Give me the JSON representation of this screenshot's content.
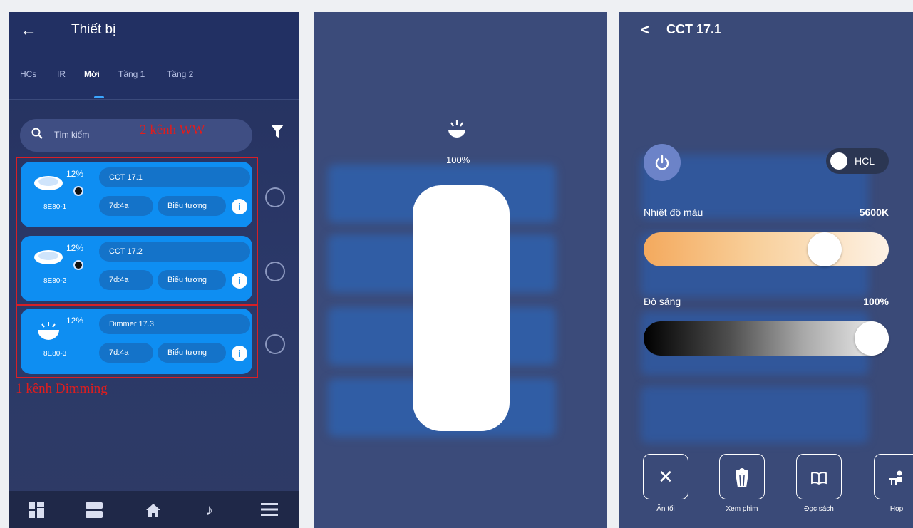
{
  "panel1": {
    "header": {
      "back_icon": "arrow-left-icon",
      "title": "Thiết bị"
    },
    "tabs": [
      {
        "label": "HCs",
        "active": false
      },
      {
        "label": "IR",
        "active": false
      },
      {
        "label": "Mới",
        "active": true
      },
      {
        "label": "Tầng 1",
        "active": false
      },
      {
        "label": "Tầng 2",
        "active": false
      }
    ],
    "search": {
      "placeholder": "Tìm kiếm",
      "icon": "search-icon"
    },
    "filter_icon": "filter-icon",
    "annotations": {
      "top": "2 kênh WW",
      "bottom": "1 kênh Dimming"
    },
    "devices": [
      {
        "percent": "12%",
        "name": "CCT 17.1",
        "id": "8E80-1",
        "room": "7d:4a",
        "icon_label": "Biểu tượng",
        "type": "ceiling-lamp"
      },
      {
        "percent": "12%",
        "name": "CCT 17.2",
        "id": "8E80-2",
        "room": "7d:4a",
        "icon_label": "Biểu tượng",
        "type": "ceiling-lamp"
      },
      {
        "percent": "12%",
        "name": "Dimmer 17.3",
        "id": "8E80-3",
        "room": "7d:4a",
        "icon_label": "Biểu tượng",
        "type": "dimmer-lamp"
      }
    ],
    "bottom_nav": [
      "grid-icon",
      "rooms-icon",
      "home-icon",
      "music-icon",
      "menu-icon"
    ]
  },
  "panel2": {
    "brightness_label": "100%",
    "brightness_level": 1.0,
    "icon": "lamp-icon"
  },
  "panel3": {
    "title": "CCT 17.1",
    "hcl_label": "HCL",
    "color_temp": {
      "label": "Nhiệt độ màu",
      "value": "5600K",
      "level": 0.72
    },
    "brightness": {
      "label": "Độ sáng",
      "value": "100%",
      "level": 1.0
    },
    "scenes": [
      {
        "label": "Ăn tối",
        "icon": "fork-knife-icon"
      },
      {
        "label": "Xem phim",
        "icon": "popcorn-icon"
      },
      {
        "label": "Đọc sách",
        "icon": "book-icon"
      },
      {
        "label": "Họp",
        "icon": "meeting-icon"
      }
    ]
  }
}
